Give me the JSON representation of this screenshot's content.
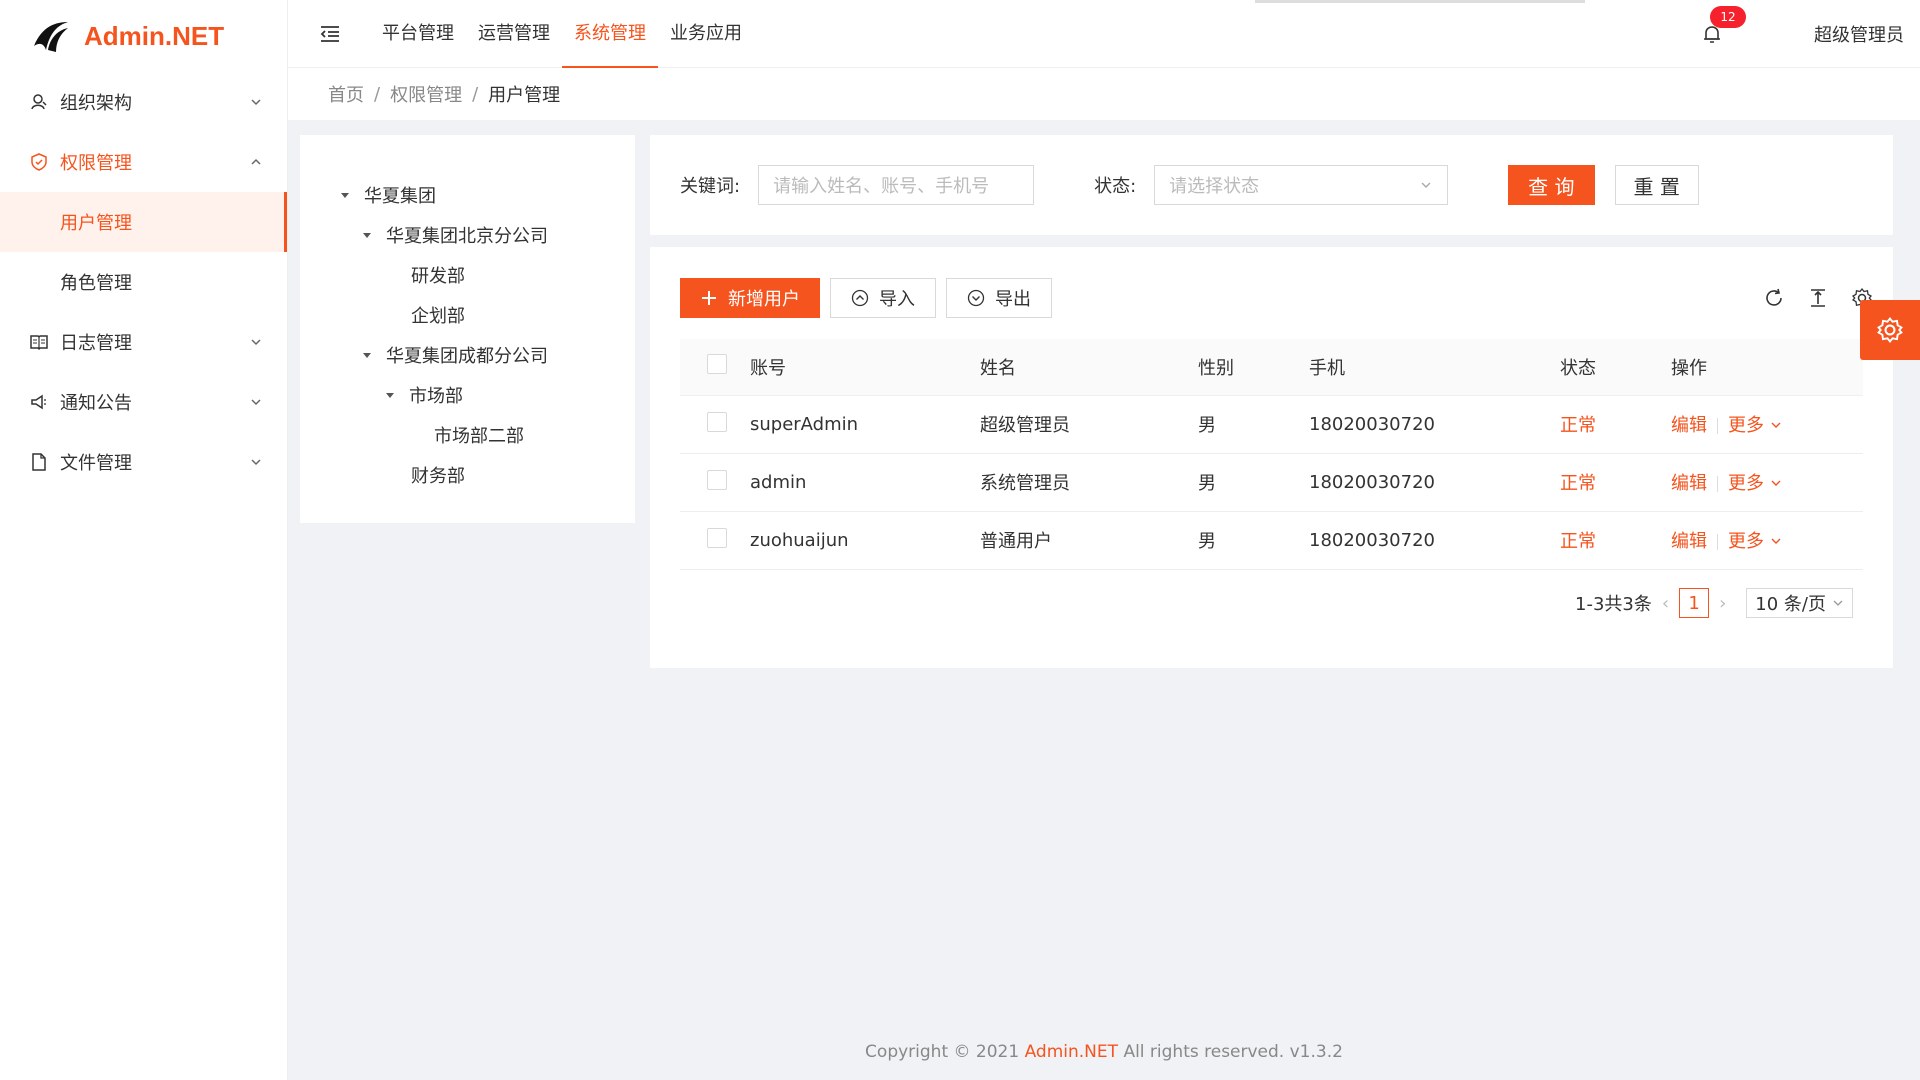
{
  "app": {
    "name": "Admin.NET"
  },
  "sidebar": {
    "items": [
      {
        "label": "组织架构",
        "icon": "org-icon",
        "expanded": false
      },
      {
        "label": "权限管理",
        "icon": "shield-icon",
        "expanded": true,
        "children": [
          {
            "label": "用户管理",
            "selected": true
          },
          {
            "label": "角色管理",
            "selected": false
          }
        ]
      },
      {
        "label": "日志管理",
        "icon": "log-icon",
        "expanded": false
      },
      {
        "label": "通知公告",
        "icon": "speaker-icon",
        "expanded": false
      },
      {
        "label": "文件管理",
        "icon": "file-icon",
        "expanded": false
      }
    ]
  },
  "header": {
    "nav": [
      "平台管理",
      "运营管理",
      "系统管理",
      "业务应用"
    ],
    "active_nav": "系统管理",
    "notification_count": "12",
    "user": "超级管理员"
  },
  "breadcrumb": [
    "首页",
    "权限管理",
    "用户管理"
  ],
  "tree": {
    "root": "华夏集团",
    "nodes": [
      {
        "label": "华夏集团北京分公司",
        "children": [
          "研发部",
          "企划部"
        ]
      },
      {
        "label": "华夏集团成都分公司",
        "children": [
          {
            "label": "市场部",
            "children": [
              "市场部二部"
            ]
          },
          "财务部"
        ]
      }
    ]
  },
  "search": {
    "keyword_label": "关键词:",
    "keyword_placeholder": "请输入姓名、账号、手机号",
    "status_label": "状态:",
    "status_placeholder": "请选择状态",
    "query_button": "查 询",
    "reset_button": "重 置"
  },
  "toolbar": {
    "add": "新增用户",
    "import": "导入",
    "export": "导出"
  },
  "table": {
    "headers": [
      "账号",
      "姓名",
      "性别",
      "手机",
      "状态",
      "操作"
    ],
    "rows": [
      {
        "account": "superAdmin",
        "name": "超级管理员",
        "gender": "男",
        "phone": "18020030720",
        "status": "正常"
      },
      {
        "account": "admin",
        "name": "系统管理员",
        "gender": "男",
        "phone": "18020030720",
        "status": "正常"
      },
      {
        "account": "zuohuaijun",
        "name": "普通用户",
        "gender": "男",
        "phone": "18020030720",
        "status": "正常"
      }
    ],
    "actions": {
      "edit": "编辑",
      "more": "更多"
    }
  },
  "pagination": {
    "summary": "1-3共3条",
    "current": "1",
    "page_size": "10 条/页"
  },
  "footer": {
    "prefix": "Copyright © 2021",
    "brand": "Admin.NET",
    "suffix": "All rights reserved. v1.3.2"
  },
  "colors": {
    "accent": "#f5541e",
    "badge": "#f5222d"
  }
}
